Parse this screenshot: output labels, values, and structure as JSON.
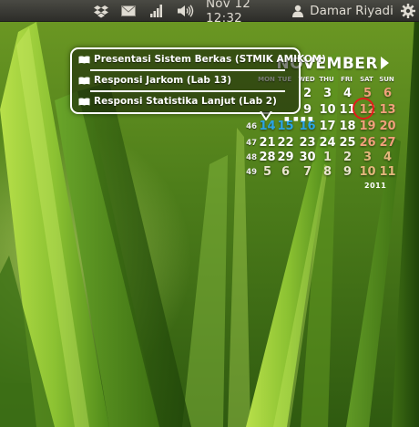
{
  "panel": {
    "icons": [
      "dropbox-icon",
      "mail-icon",
      "network-signal-icon",
      "volume-icon",
      "user-icon",
      "gear-icon"
    ],
    "clock": "Nov 12 12:32",
    "user_name": "Damar Riyadi"
  },
  "calendar": {
    "month": "NOVEMBER",
    "year": "2011",
    "weekdays": [
      "MON",
      "TUE",
      "WED",
      "THU",
      "FRI",
      "SAT",
      "SUN"
    ],
    "weeks": [
      {
        "week": "",
        "days": [
          "",
          "",
          "2",
          "3",
          "4",
          "5",
          "6"
        ]
      },
      {
        "week": "",
        "days": [
          "",
          "",
          "9",
          "10",
          "11",
          "12",
          "13"
        ]
      },
      {
        "week": "46",
        "days": [
          "14",
          "15",
          "16",
          "17",
          "18",
          "19",
          "20"
        ]
      },
      {
        "week": "47",
        "days": [
          "21",
          "22",
          "23",
          "24",
          "25",
          "26",
          "27"
        ]
      },
      {
        "week": "48",
        "days": [
          "28",
          "29",
          "30",
          "1",
          "2",
          "3",
          "4"
        ]
      },
      {
        "week": "49",
        "days": [
          "5",
          "6",
          "7",
          "8",
          "9",
          "10",
          "11"
        ]
      }
    ],
    "today": "12",
    "event_days": [
      "14",
      "15",
      "16"
    ],
    "colors": {
      "weekend": "#f0a07c",
      "event": "#2aa4e6",
      "today_ring": "#e21b1b"
    }
  },
  "events": {
    "items": [
      "Presentasi Sistem Berkas (STMIK AMIKOM)",
      "Responsi Jarkom (Lab 13)",
      "Responsi Statistika Lanjut (Lab 2)"
    ]
  }
}
